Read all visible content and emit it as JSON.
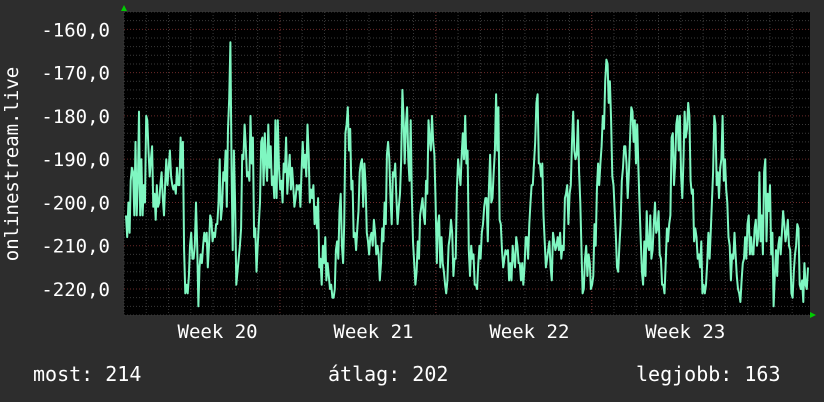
{
  "chart_data": {
    "type": "line",
    "ylabel": "onlinestream.live",
    "y_ticks": [
      "-160,0",
      "-170,0",
      "-180,0",
      "-190,0",
      "-200,0",
      "-210,0",
      "-220,0"
    ],
    "y_tick_values": [
      -160,
      -170,
      -180,
      -190,
      -200,
      -210,
      -220
    ],
    "ylim": [
      -226,
      -156
    ],
    "x_ticks": [
      "Week 20",
      "Week 21",
      "Week 22",
      "Week 23"
    ],
    "x_tick_positions": [
      19.6,
      20.6,
      21.6,
      22.6
    ],
    "xlim": [
      19.0,
      23.4
    ],
    "grid": true,
    "colors": {
      "background": "#2d2d2d",
      "plot_background": "#000000",
      "line": "#7ff7c1",
      "grid_major": "#6b2a2a",
      "grid_minor": "#3a3a3a",
      "axis_arrow": "#00cc00"
    },
    "series": [
      {
        "values": [
          -203,
          -208,
          -200,
          -207,
          -195,
          -192,
          -193,
          -203,
          -186,
          -203,
          -195,
          -179,
          -203,
          -190,
          -203,
          -196,
          -200,
          -180,
          -181,
          -188,
          -194,
          -190,
          -187,
          -201,
          -198,
          -204,
          -196,
          -201,
          -200,
          -196,
          -193,
          -199,
          -203,
          -196,
          -190,
          -196,
          -192,
          -188,
          -194,
          -196,
          -197,
          -196,
          -198,
          -192,
          -196,
          -196,
          -185,
          -192,
          -186,
          -211,
          -221,
          -219,
          -221,
          -217,
          -210,
          -207,
          -213,
          -213,
          -210,
          -200,
          -210,
          -224,
          -215,
          -212,
          -214,
          -210,
          -207,
          -209,
          -207,
          -215,
          -210,
          -203,
          -204,
          -209,
          -207,
          -208,
          -205,
          -205,
          -200,
          -190,
          -204,
          -201,
          -193,
          -195,
          -188,
          -201,
          -183,
          -176,
          -163,
          -193,
          -211,
          -188,
          -200,
          -219,
          -216,
          -213,
          -210,
          -206,
          -189,
          -190,
          -182,
          -187,
          -194,
          -193,
          -195,
          -180,
          -191,
          -185,
          -208,
          -206,
          -216,
          -210,
          -205,
          -200,
          -186,
          -185,
          -196,
          -184,
          -191,
          -195,
          -182,
          -192,
          -187,
          -196,
          -194,
          -199,
          -181,
          -199,
          -181,
          -192,
          -197,
          -195,
          -200,
          -191,
          -193,
          -185,
          -198,
          -193,
          -189,
          -197,
          -192,
          -196,
          -201,
          -199,
          -196,
          -197,
          -196,
          -201,
          -193,
          -186,
          -192,
          -189,
          -194,
          -182,
          -189,
          -200,
          -197,
          -199,
          -196,
          -205,
          -201,
          -206,
          -199,
          -215,
          -213,
          -219,
          -210,
          -214,
          -208,
          -218,
          -214,
          -217,
          -220,
          -219,
          -222,
          -222,
          -220,
          -211,
          -209,
          -213,
          -202,
          -198,
          -210,
          -214,
          -205,
          -184,
          -182,
          -178,
          -188,
          -183,
          -197,
          -195,
          -208,
          -207,
          -211,
          -206,
          -202,
          -193,
          -191,
          -190,
          -201,
          -191,
          -196,
          -207,
          -209,
          -212,
          -208,
          -207,
          -210,
          -204,
          -207,
          -212,
          -210,
          -212,
          -218,
          -214,
          -206,
          -209,
          -200,
          -205,
          -189,
          -186,
          -190,
          -199,
          -205,
          -193,
          -194,
          -191,
          -199,
          -205,
          -201,
          -198,
          -190,
          -174,
          -180,
          -191,
          -182,
          -178,
          -190,
          -195,
          -181,
          -198,
          -209,
          -214,
          -219,
          -216,
          -209,
          -213,
          -203,
          -201,
          -199,
          -203,
          -205,
          -195,
          -198,
          -181,
          -185,
          -188,
          -180,
          -186,
          -189,
          -200,
          -214,
          -205,
          -203,
          -215,
          -208,
          -214,
          -216,
          -219,
          -221,
          -218,
          -210,
          -208,
          -204,
          -207,
          -217,
          -213,
          -213,
          -197,
          -190,
          -193,
          -196,
          -189,
          -184,
          -190,
          -180,
          -191,
          -188,
          -211,
          -217,
          -210,
          -213,
          -212,
          -219,
          -219,
          -220,
          -214,
          -210,
          -213,
          -207,
          -205,
          -201,
          -199,
          -199,
          -209,
          -197,
          -189,
          -200,
          -199,
          -193,
          -188,
          -175,
          -188,
          -178,
          -204,
          -205,
          -211,
          -215,
          -213,
          -211,
          -212,
          -211,
          -218,
          -214,
          -218,
          -210,
          -213,
          -215,
          -208,
          -210,
          -214,
          -214,
          -218,
          -214,
          -219,
          -215,
          -208,
          -208,
          -213,
          -205,
          -200,
          -196,
          -196,
          -191,
          -186,
          -177,
          -175,
          -191,
          -191,
          -194,
          -191,
          -203,
          -209,
          -215,
          -213,
          -211,
          -209,
          -215,
          -218,
          -207,
          -209,
          -211,
          -210,
          -208,
          -211,
          -207,
          -213,
          -210,
          -211,
          -199,
          -198,
          -196,
          -205,
          -198,
          -196,
          -186,
          -179,
          -188,
          -190,
          -189,
          -181,
          -193,
          -200,
          -211,
          -221,
          -220,
          -213,
          -210,
          -217,
          -212,
          -214,
          -220,
          -219,
          -217,
          -205,
          -210,
          -197,
          -191,
          -196,
          -191,
          -187,
          -180,
          -183,
          -172,
          -167,
          -168,
          -177,
          -172,
          -181,
          -194,
          -196,
          -202,
          -208,
          -215,
          -216,
          -210,
          -205,
          -195,
          -192,
          -187,
          -187,
          -191,
          -199,
          -193,
          -185,
          -178,
          -179,
          -186,
          -181,
          -191,
          -182,
          -192,
          -201,
          -209,
          -216,
          -219,
          -209,
          -217,
          -202,
          -210,
          -211,
          -203,
          -213,
          -211,
          -205,
          -200,
          -207,
          -206,
          -202,
          -212,
          -213,
          -219,
          -219,
          -221,
          -214,
          -206,
          -209,
          -205,
          -203,
          -185,
          -184,
          -196,
          -191,
          -182,
          -180,
          -188,
          -180,
          -194,
          -199,
          -190,
          -179,
          -185,
          -183,
          -177,
          -180,
          -195,
          -198,
          -197,
          -209,
          -206,
          -208,
          -213,
          -212,
          -215,
          -209,
          -221,
          -219,
          -221,
          -219,
          -214,
          -207,
          -213,
          -207,
          -200,
          -193,
          -180,
          -182,
          -196,
          -193,
          -199,
          -192,
          -190,
          -180,
          -195,
          -190,
          -197,
          -200,
          -208,
          -210,
          -218,
          -212,
          -213,
          -207,
          -212,
          -217,
          -220,
          -221,
          -223,
          -218,
          -214,
          -213,
          -208,
          -213,
          -205,
          -203,
          -212,
          -208,
          -212,
          -212,
          -206,
          -204,
          -210,
          -208,
          -193,
          -209,
          -203,
          -212,
          -193,
          -190,
          -209,
          -198,
          -202,
          -196,
          -212,
          -207,
          -224,
          -217,
          -211,
          -217,
          -210,
          -208,
          -212,
          -207,
          -202,
          -205,
          -209,
          -207,
          -204,
          -210,
          -211,
          -221,
          -222,
          -216,
          -212,
          -210,
          -205,
          -206,
          -219,
          -220,
          -218,
          -223,
          -214,
          -219,
          -220,
          -215
        ]
      }
    ]
  },
  "footer": {
    "current": "most: 214",
    "average": "átlag: 202",
    "best": "legjobb: 163"
  }
}
